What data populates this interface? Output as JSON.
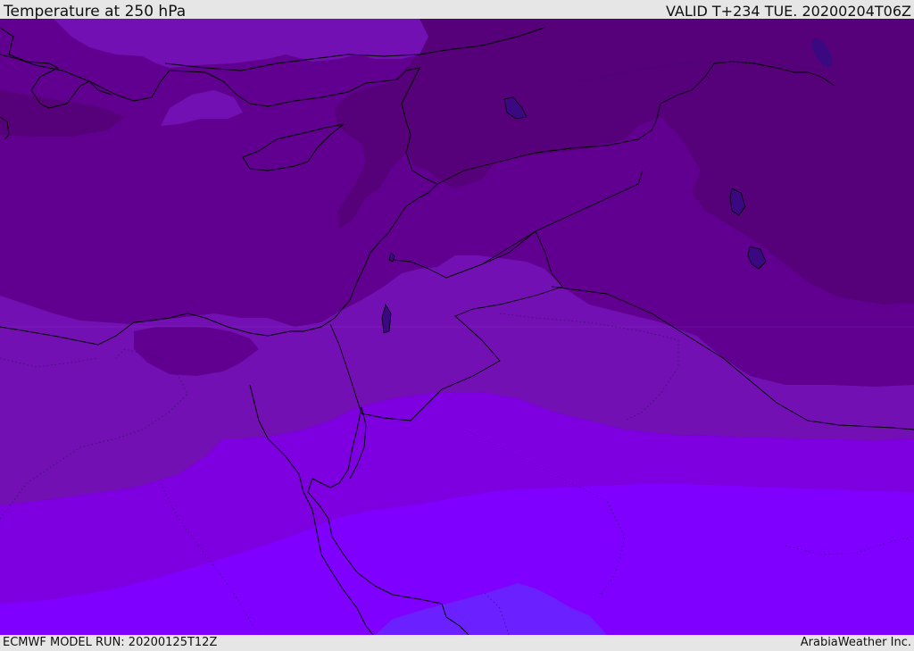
{
  "header": {
    "title": "Temperature at 250 hPa",
    "valid": "VALID T+234 TUE. 20200204T06Z"
  },
  "footer": {
    "model_run": "ECMWF MODEL RUN: 20200125T12Z",
    "credit": "ArabiaWeather Inc."
  },
  "map": {
    "colors": {
      "darkest": "#560079",
      "dark": "#610090",
      "medium": "#7310b4",
      "violet": "#7e00e0",
      "bright": "#8000ff",
      "blue_violet": "#6a20ff",
      "deep_spot": "#3a0880"
    }
  }
}
